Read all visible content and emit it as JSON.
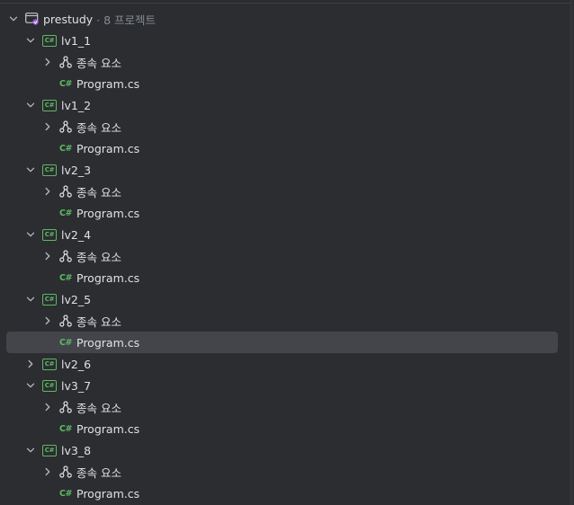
{
  "solution": {
    "name": "prestudy",
    "meta": "· 8 프로젝트",
    "icon": "solution-icon"
  },
  "colors": {
    "background": "#2b2d30",
    "selected_row": "#43454a",
    "csharp_green": "#5fb865",
    "text": "#dfe1e5",
    "muted_text": "#868a91"
  },
  "labels": {
    "dependencies": "종속 요소",
    "project_badge": "C#",
    "file_badge": "C#"
  },
  "projects": [
    {
      "name": "lv1_1",
      "expanded": true,
      "file": "Program.cs"
    },
    {
      "name": "lv1_2",
      "expanded": true,
      "file": "Program.cs"
    },
    {
      "name": "lv2_3",
      "expanded": true,
      "file": "Program.cs"
    },
    {
      "name": "lv2_4",
      "expanded": true,
      "file": "Program.cs"
    },
    {
      "name": "lv2_5",
      "expanded": true,
      "file": "Program.cs",
      "file_selected": true
    },
    {
      "name": "lv2_6",
      "expanded": false
    },
    {
      "name": "lv3_7",
      "expanded": true,
      "file": "Program.cs"
    },
    {
      "name": "lv3_8",
      "expanded": true,
      "file": "Program.cs"
    }
  ]
}
